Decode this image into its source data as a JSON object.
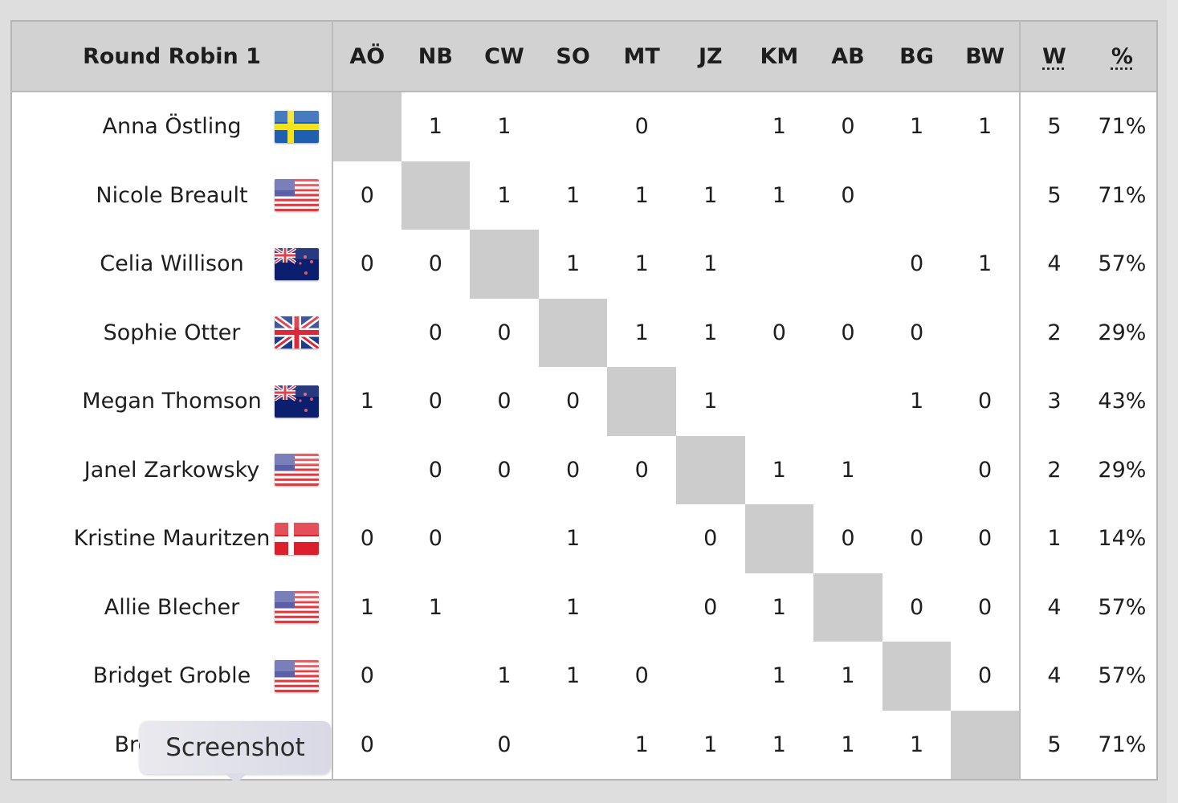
{
  "table": {
    "title": "Round Robin 1",
    "opponent_headers": [
      "AÖ",
      "NB",
      "CW",
      "SO",
      "MT",
      "JZ",
      "KM",
      "AB",
      "BG",
      "BW"
    ],
    "wins_header": "W",
    "pct_header": "%",
    "rows": [
      {
        "name": "Anna Östling",
        "flag": "sweden-flag-icon",
        "results": [
          "",
          "1",
          "1",
          "",
          "0",
          "",
          "1",
          "0",
          "1",
          "1"
        ],
        "wins": "5",
        "pct": "71%"
      },
      {
        "name": "Nicole Breault",
        "flag": "usa-flag-icon",
        "results": [
          "0",
          "",
          "1",
          "1",
          "1",
          "1",
          "1",
          "0",
          "",
          ""
        ],
        "wins": "5",
        "pct": "71%"
      },
      {
        "name": "Celia Willison",
        "flag": "new-zealand-flag-icon",
        "results": [
          "0",
          "0",
          "",
          "1",
          "1",
          "1",
          "",
          "",
          "0",
          "1"
        ],
        "wins": "4",
        "pct": "57%"
      },
      {
        "name": "Sophie Otter",
        "flag": "uk-flag-icon",
        "results": [
          "",
          "0",
          "0",
          "",
          "1",
          "1",
          "0",
          "0",
          "0",
          ""
        ],
        "wins": "2",
        "pct": "29%"
      },
      {
        "name": "Megan Thomson",
        "flag": "new-zealand-flag-icon",
        "results": [
          "1",
          "0",
          "0",
          "0",
          "",
          "1",
          "",
          "",
          "1",
          "0"
        ],
        "wins": "3",
        "pct": "43%"
      },
      {
        "name": "Janel Zarkowsky",
        "flag": "usa-flag-icon",
        "results": [
          "",
          "0",
          "0",
          "0",
          "0",
          "",
          "1",
          "1",
          "",
          "0"
        ],
        "wins": "2",
        "pct": "29%"
      },
      {
        "name": "Kristine Mauritzen",
        "flag": "denmark-flag-icon",
        "results": [
          "0",
          "0",
          "",
          "1",
          "",
          "0",
          "",
          "0",
          "0",
          "0"
        ],
        "wins": "1",
        "pct": "14%"
      },
      {
        "name": "Allie Blecher",
        "flag": "usa-flag-icon",
        "results": [
          "1",
          "1",
          "",
          "1",
          "",
          "0",
          "1",
          "",
          "0",
          "0"
        ],
        "wins": "4",
        "pct": "57%"
      },
      {
        "name": "Bridget Groble",
        "flag": "usa-flag-icon",
        "results": [
          "0",
          "",
          "1",
          "1",
          "0",
          "",
          "1",
          "1",
          "",
          "0"
        ],
        "wins": "4",
        "pct": "57%"
      },
      {
        "name": "Brooke Wil",
        "flag": "hidden",
        "results": [
          "0",
          "",
          "0",
          "",
          "1",
          "1",
          "1",
          "1",
          "1",
          ""
        ],
        "wins": "5",
        "pct": "71%"
      }
    ]
  },
  "tooltip": {
    "label": "Screenshot"
  },
  "colors": {
    "header_bg": "#d2d2d2",
    "diagonal_bg": "#cccccc",
    "page_bg": "#dedede"
  }
}
